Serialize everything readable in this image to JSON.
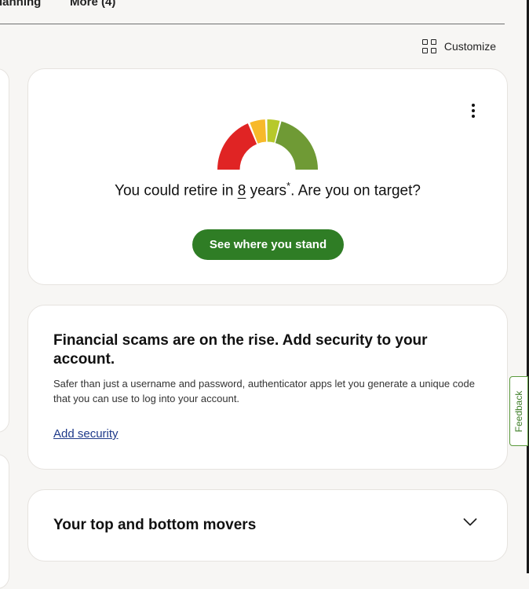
{
  "nav": {
    "items": [
      "Planning",
      "More (4)"
    ]
  },
  "customize": {
    "label": "Customize",
    "icon": "grid-icon"
  },
  "retirement": {
    "prefix": "You could retire in ",
    "years": "8",
    "suffix": " years",
    "asterisk": "*",
    "question": ". Are you on target?",
    "button_label": "See where you stand",
    "gauge_colors": [
      "#e02424",
      "#f7b92a",
      "#b7c92b",
      "#6f9a35"
    ]
  },
  "security": {
    "title": "Financial scams are on the rise. Add security to your account.",
    "description": "Safer than just a username and password, authenticator apps let you generate a unique code that you can use to log into your account.",
    "link_label": "Add security"
  },
  "movers": {
    "title": "Your top and bottom movers"
  },
  "feedback": {
    "label": "Feedback"
  },
  "colors": {
    "primary_button": "#2f7d25",
    "link": "#1f3a8a",
    "background": "#f7f6f4"
  }
}
